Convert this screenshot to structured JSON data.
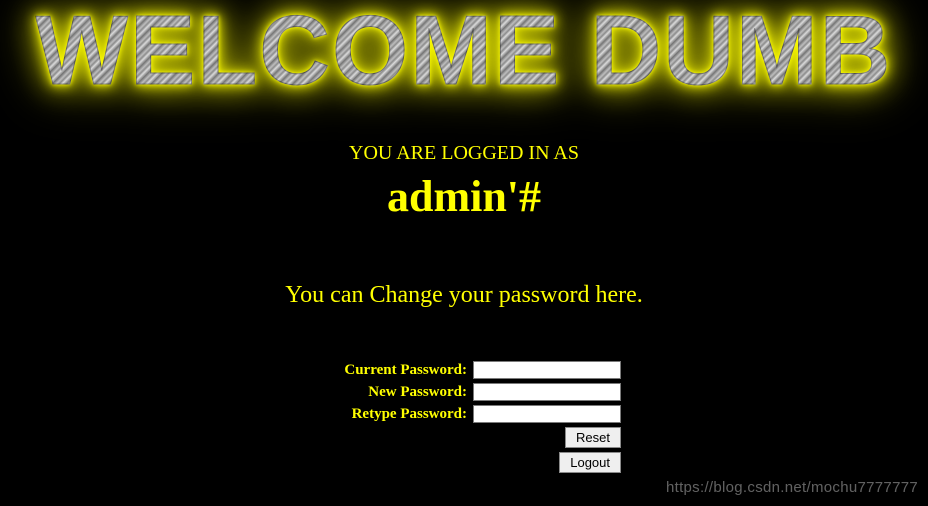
{
  "banner": {
    "text": "WELCOME DUMB"
  },
  "status": {
    "logged_in_as_label": "YOU ARE LOGGED IN AS",
    "username": "admin'#",
    "change_password_message": "You can Change your password here."
  },
  "form": {
    "current_password": {
      "label": "Current Password:",
      "value": ""
    },
    "new_password": {
      "label": "New Password:",
      "value": ""
    },
    "retype_password": {
      "label": "Retype Password:",
      "value": ""
    },
    "reset_label": "Reset",
    "logout_label": "Logout"
  },
  "watermark": "https://blog.csdn.net/mochu7777777",
  "colors": {
    "accent": "#FFFF00",
    "background": "#000000"
  }
}
